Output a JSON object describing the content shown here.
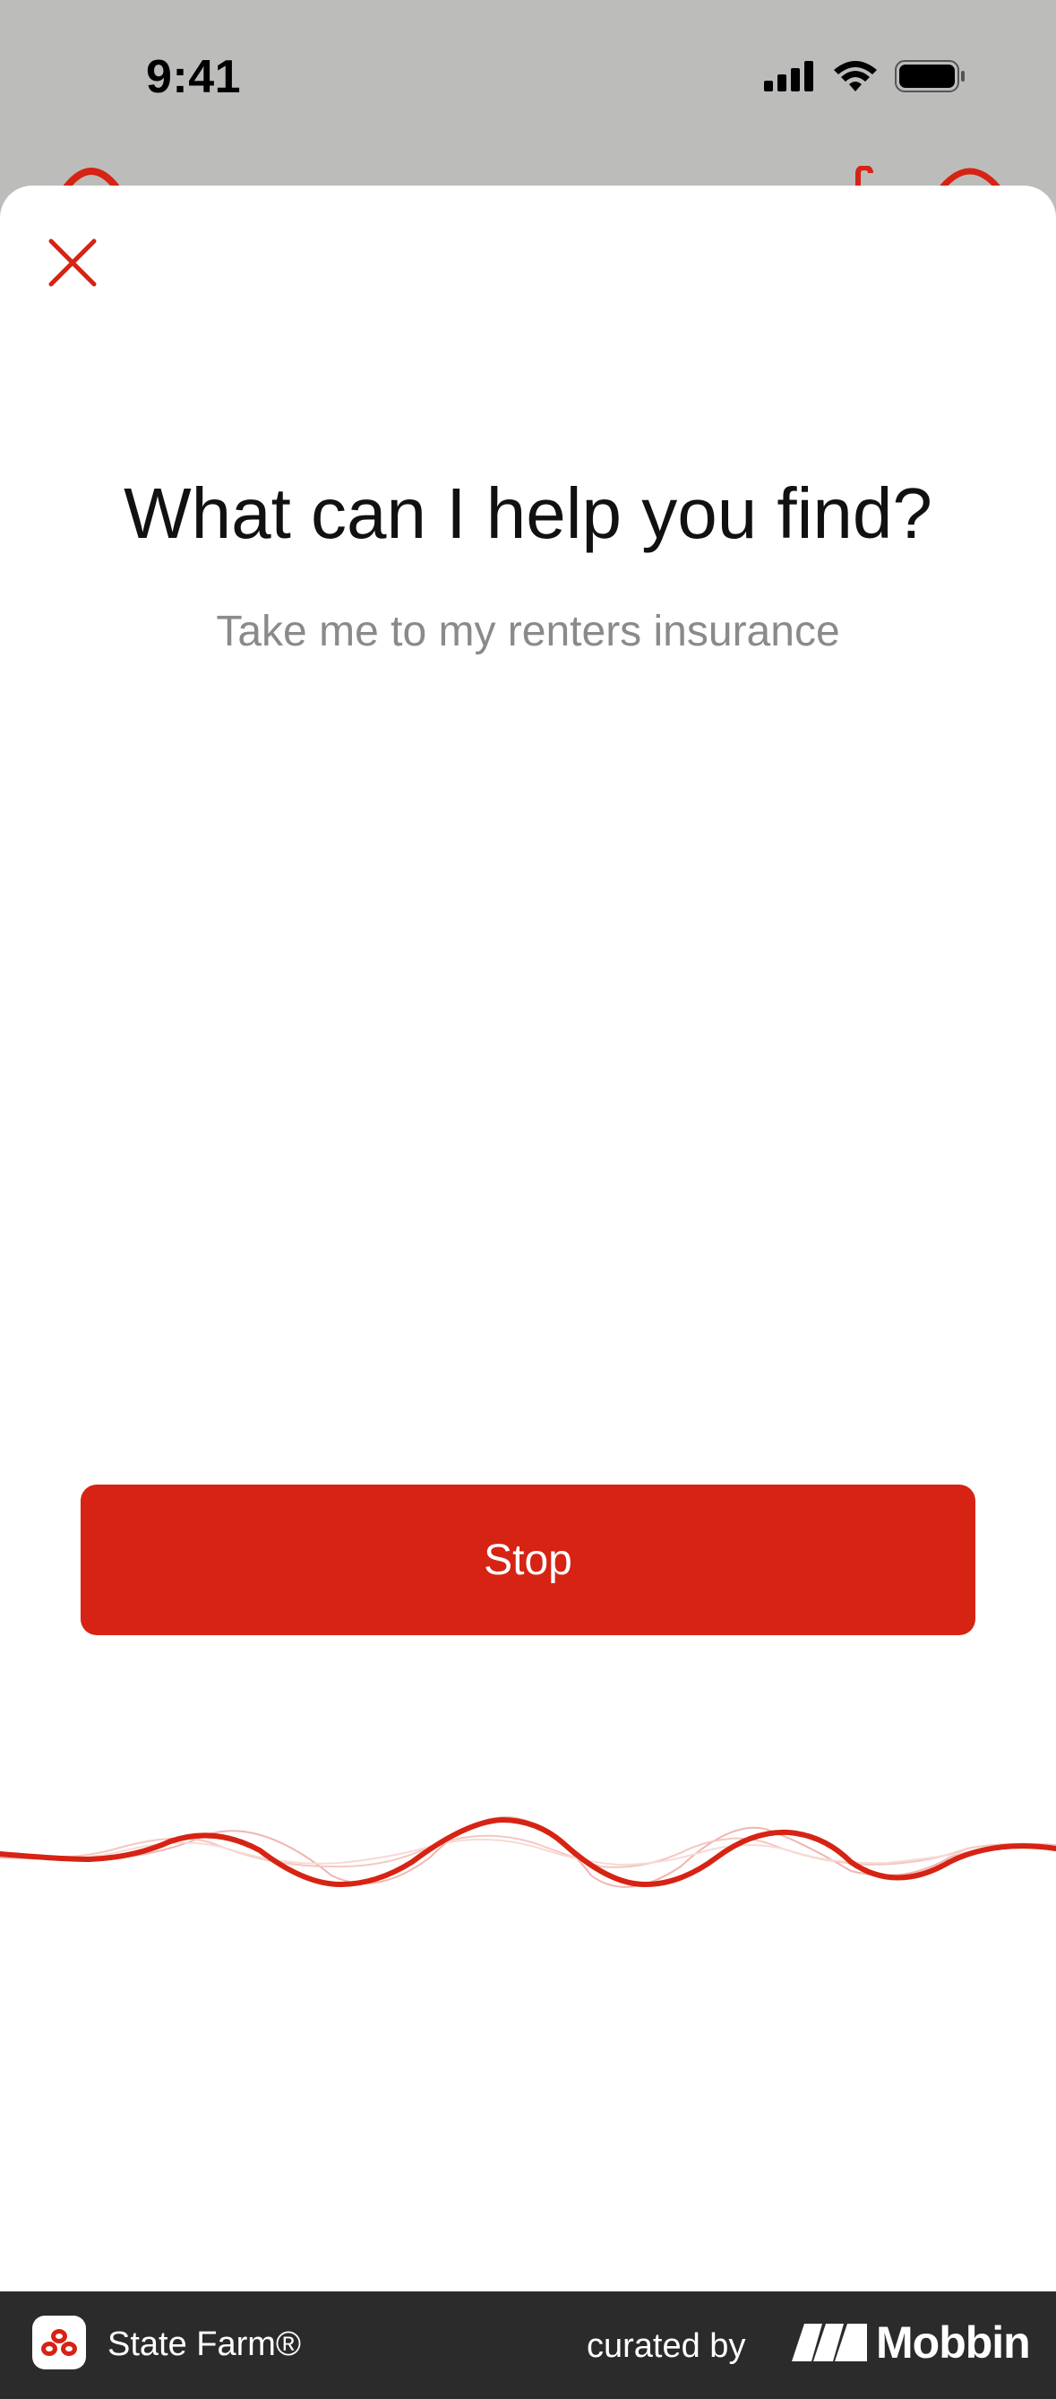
{
  "status_bar": {
    "time": "9:41"
  },
  "sheet": {
    "headline": "What can I help you find?",
    "transcript": "Take me to my renters insurance",
    "stop_label": "Stop"
  },
  "footer": {
    "app_name": "State Farm®",
    "curated_by": "curated by",
    "brand": "Mobbin"
  },
  "colors": {
    "accent": "#d62314",
    "status_bg": "#bcbdbb",
    "footer_bg": "#2b2b2b",
    "subtle_text": "#8a8a8a"
  },
  "icons": [
    "signal-icon",
    "wifi-icon",
    "battery-icon",
    "close-icon",
    "voice-wave-icon",
    "state-farm-logo-icon",
    "mobbin-logo-icon"
  ]
}
